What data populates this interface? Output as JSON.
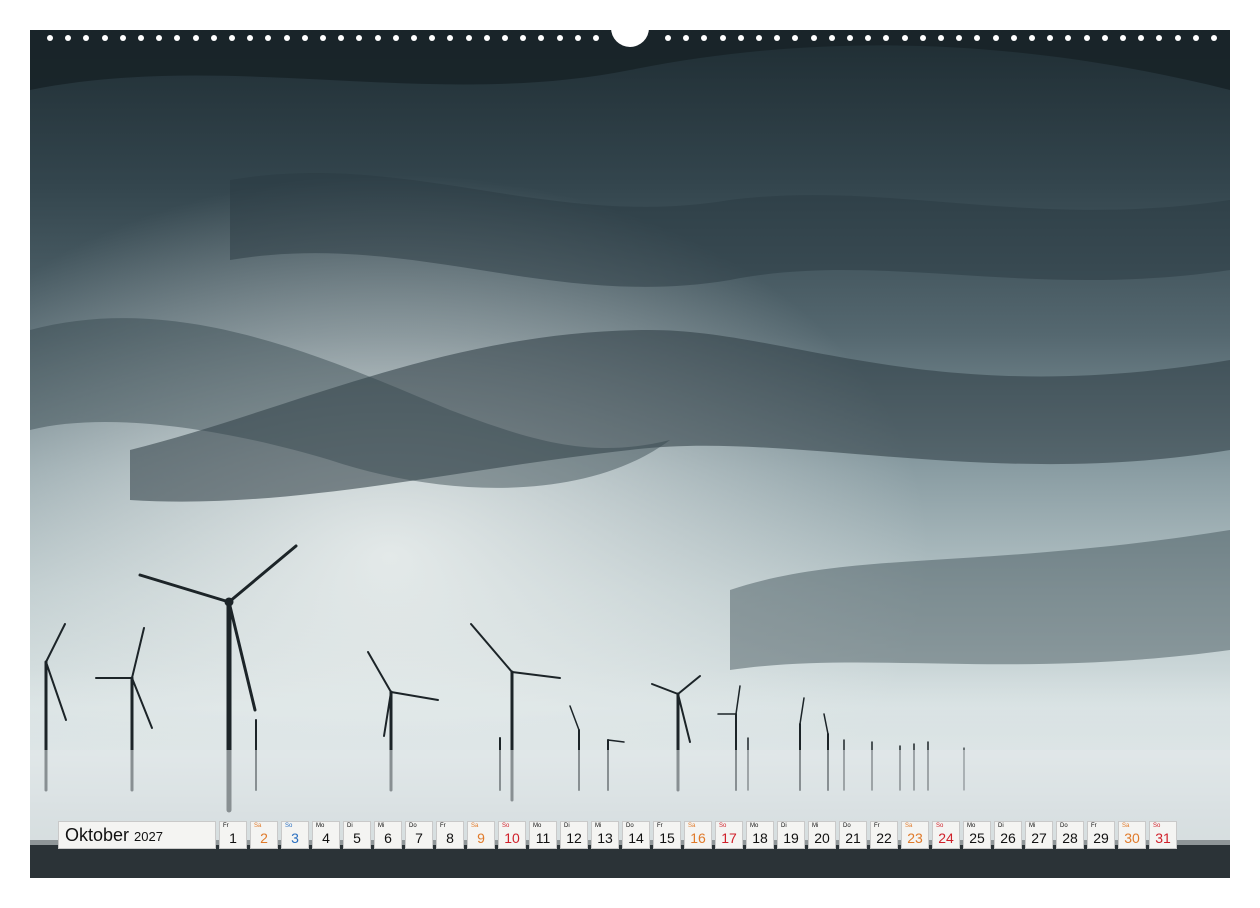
{
  "calendar": {
    "month": "Oktober",
    "year": "2027",
    "days": [
      {
        "wd": "Fr",
        "n": "1",
        "type": "weekday"
      },
      {
        "wd": "Sa",
        "n": "2",
        "type": "sat"
      },
      {
        "wd": "So",
        "n": "3",
        "type": "holiday"
      },
      {
        "wd": "Mo",
        "n": "4",
        "type": "weekday"
      },
      {
        "wd": "Di",
        "n": "5",
        "type": "weekday"
      },
      {
        "wd": "Mi",
        "n": "6",
        "type": "weekday"
      },
      {
        "wd": "Do",
        "n": "7",
        "type": "weekday"
      },
      {
        "wd": "Fr",
        "n": "8",
        "type": "weekday"
      },
      {
        "wd": "Sa",
        "n": "9",
        "type": "sat"
      },
      {
        "wd": "So",
        "n": "10",
        "type": "sun"
      },
      {
        "wd": "Mo",
        "n": "11",
        "type": "weekday"
      },
      {
        "wd": "Di",
        "n": "12",
        "type": "weekday"
      },
      {
        "wd": "Mi",
        "n": "13",
        "type": "weekday"
      },
      {
        "wd": "Do",
        "n": "14",
        "type": "weekday"
      },
      {
        "wd": "Fr",
        "n": "15",
        "type": "weekday"
      },
      {
        "wd": "Sa",
        "n": "16",
        "type": "sat"
      },
      {
        "wd": "So",
        "n": "17",
        "type": "sun"
      },
      {
        "wd": "Mo",
        "n": "18",
        "type": "weekday"
      },
      {
        "wd": "Di",
        "n": "19",
        "type": "weekday"
      },
      {
        "wd": "Mi",
        "n": "20",
        "type": "weekday"
      },
      {
        "wd": "Do",
        "n": "21",
        "type": "weekday"
      },
      {
        "wd": "Fr",
        "n": "22",
        "type": "weekday"
      },
      {
        "wd": "Sa",
        "n": "23",
        "type": "sat"
      },
      {
        "wd": "So",
        "n": "24",
        "type": "sun"
      },
      {
        "wd": "Mo",
        "n": "25",
        "type": "weekday"
      },
      {
        "wd": "Di",
        "n": "26",
        "type": "weekday"
      },
      {
        "wd": "Mi",
        "n": "27",
        "type": "weekday"
      },
      {
        "wd": "Do",
        "n": "28",
        "type": "weekday"
      },
      {
        "wd": "Fr",
        "n": "29",
        "type": "weekday"
      },
      {
        "wd": "Sa",
        "n": "30",
        "type": "sat"
      },
      {
        "wd": "So",
        "n": "31",
        "type": "sun"
      }
    ]
  },
  "colors": {
    "saturday": "#e07a2a",
    "sunday": "#d0202a",
    "holiday": "#2a6fc0"
  },
  "photo": {
    "subject": "wind-turbines-fog-storm-clouds"
  }
}
